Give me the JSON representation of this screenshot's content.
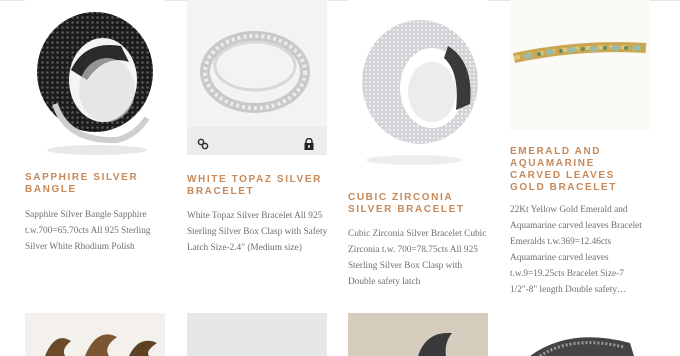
{
  "products": [
    {
      "title": "SAPPHIRE SILVER BANGLE",
      "description": "Sapphire Silver Bangle Sapphire t.w.700=65.70cts All 925 Sterling Silver White Rhodium Polish",
      "image": "black-sapphire-pave-bangle"
    },
    {
      "title": "WHITE TOPAZ SILVER BRACELET",
      "description": "White Topaz Silver Bracelet All 925 Sterling Silver Box Clasp with Safety Latch Size-2.4\" (Medium size)",
      "image": "white-topaz-bangle",
      "hover_icons": [
        "link-icon",
        "lock-icon"
      ]
    },
    {
      "title": "Cubic Zirconia Silver Bracelet",
      "description": "Cubic Zirconia Silver Bracelet Cubic Zirconia t.w. 700=78.75cts All 925 Sterling Silver Box Clasp with Double safety latch",
      "image": "cubic-zirconia-pave-bangle"
    },
    {
      "title": "EMERALD AND AQUAMARINE CARVED LEAVES GOLD BRACELET",
      "description": "22Kt Yellow Gold Emerald and Aquamarine carved leaves Bracelet Emeralds t.w.369=12.46cts Aquamarine carved leaves t.w.9=19.25cts Bracelet Size-7 1/2\"-8\" length Double safety…",
      "image": "emerald-aquamarine-leaf-bracelet"
    }
  ],
  "colors": {
    "title": "#c6895a",
    "description": "#6f6f6f",
    "divider": "#e6e6e6"
  }
}
